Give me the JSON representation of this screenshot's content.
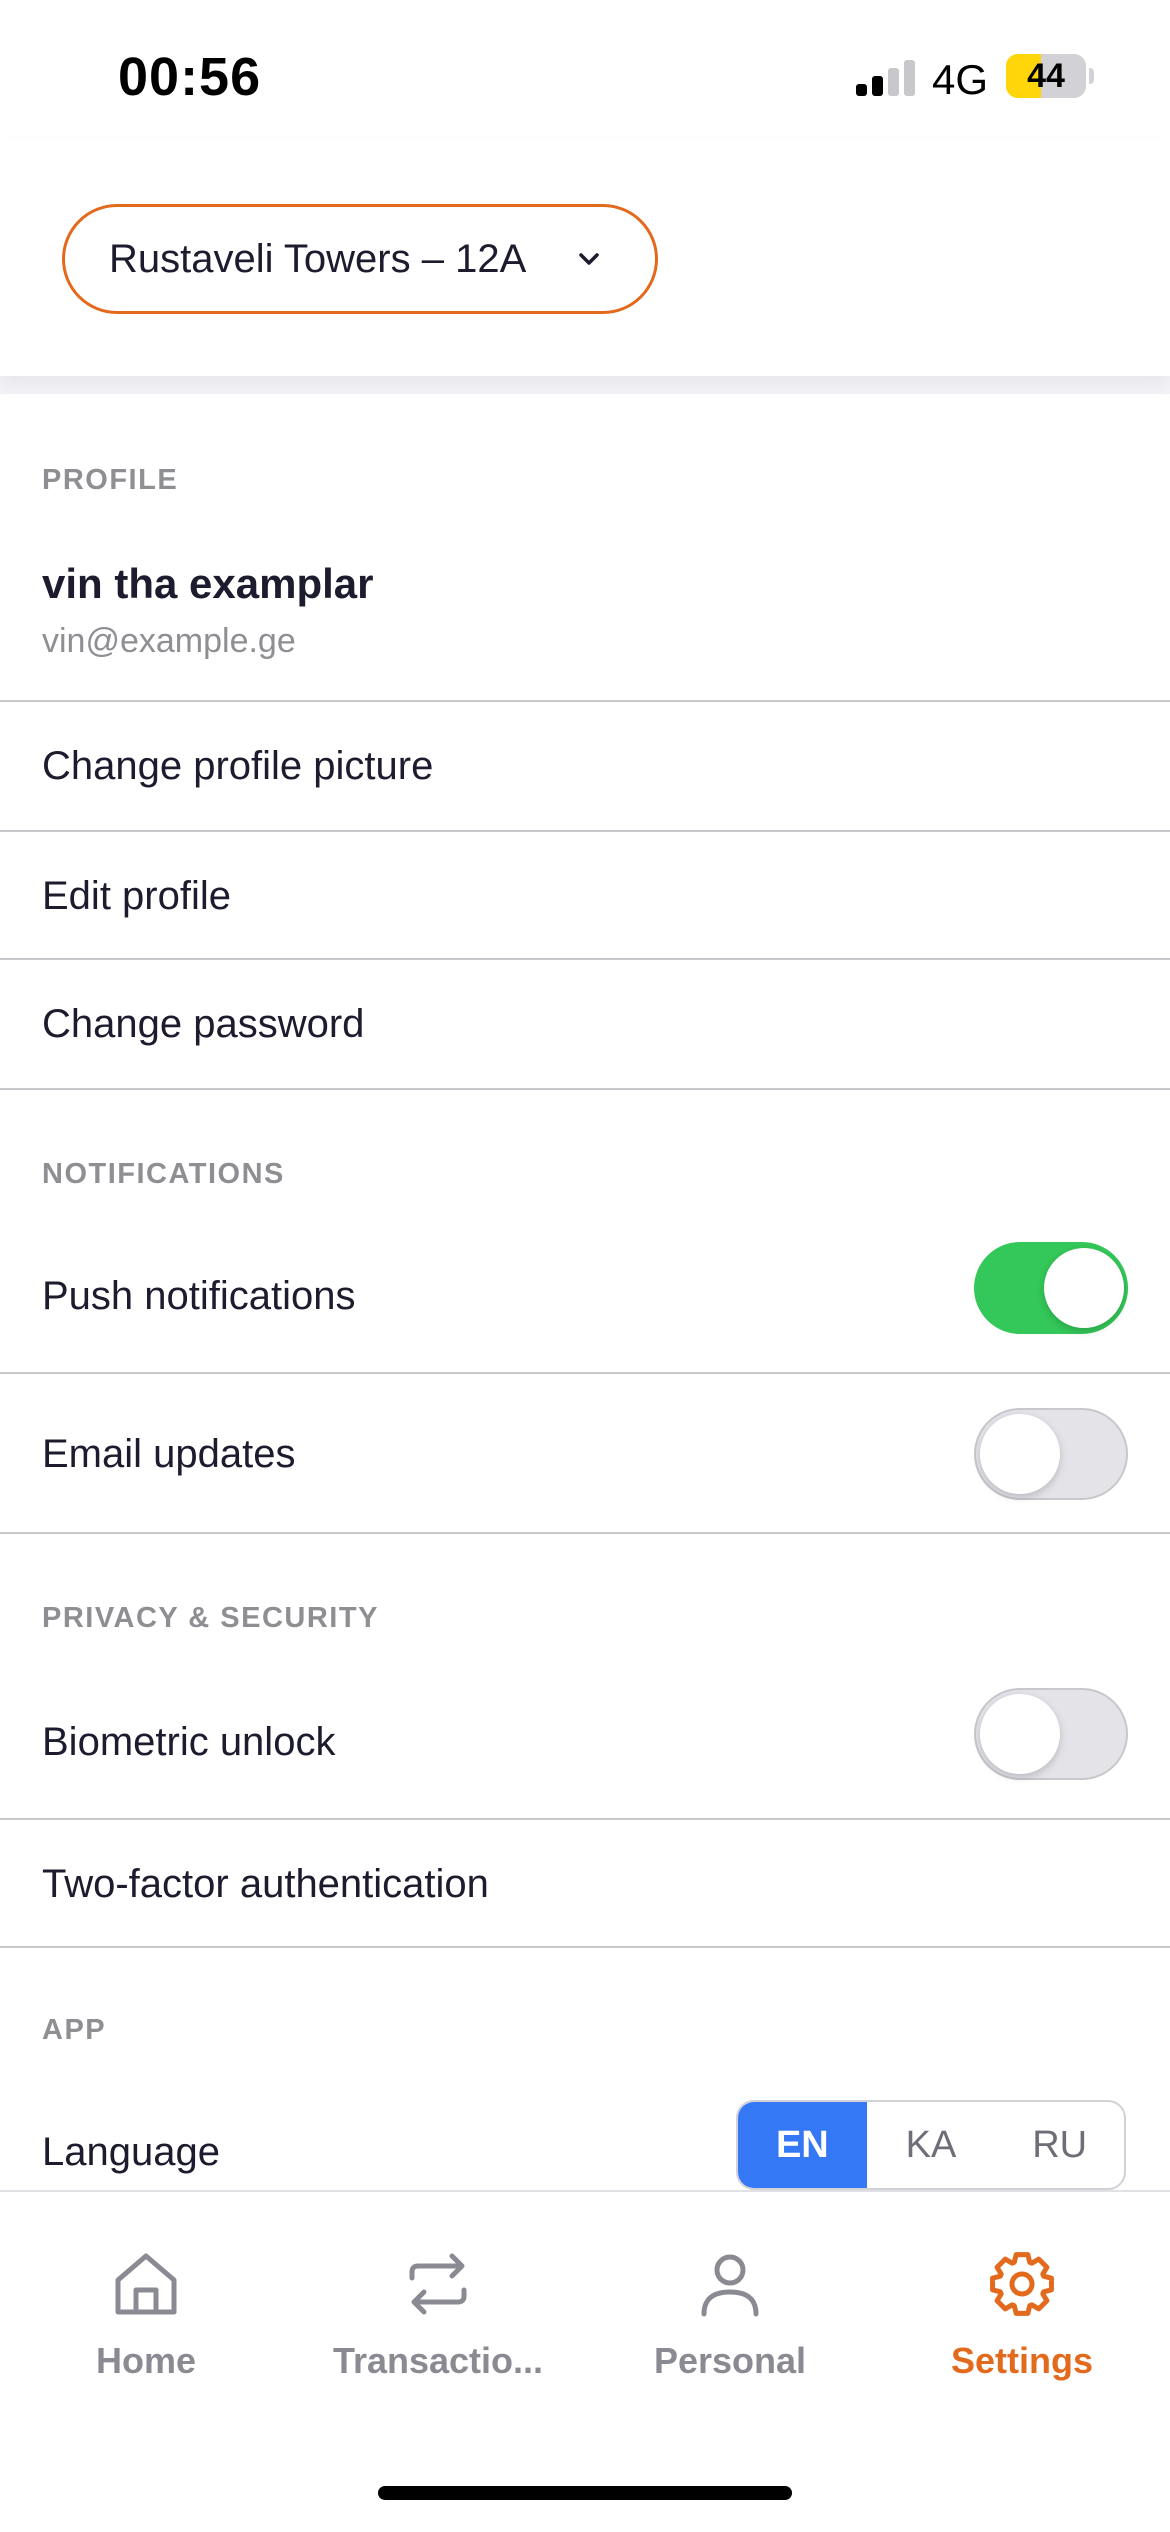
{
  "status_bar": {
    "time": "00:56",
    "network": "4G",
    "battery": "44",
    "battery_level": 0.44
  },
  "header": {
    "property_label": "Rustaveli Towers – 12A",
    "accent_color": "#e36a1c"
  },
  "profile": {
    "section_title": "PROFILE",
    "name": "vin tha examplar",
    "email": "vin@example.ge",
    "items": [
      {
        "label": "Change profile picture"
      },
      {
        "label": "Edit profile"
      },
      {
        "label": "Change password"
      }
    ]
  },
  "notifications": {
    "section_title": "NOTIFICATIONS",
    "push": {
      "label": "Push notifications",
      "enabled": true
    },
    "email": {
      "label": "Email updates",
      "enabled": false
    }
  },
  "privacy": {
    "section_title": "PRIVACY & SECURITY",
    "biometric": {
      "label": "Biometric unlock",
      "enabled": false
    },
    "two_factor": {
      "label": "Two-factor authentication"
    }
  },
  "app": {
    "section_title": "APP",
    "language": {
      "label": "Language",
      "options": [
        "EN",
        "KA",
        "RU"
      ],
      "selected": "EN"
    }
  },
  "tabbar": {
    "tabs": [
      {
        "label": "Home",
        "icon": "home-icon"
      },
      {
        "label": "Transactio...",
        "icon": "transfer-arrows-icon"
      },
      {
        "label": "Personal",
        "icon": "person-icon"
      },
      {
        "label": "Settings",
        "icon": "gear-icon",
        "active": true
      }
    ],
    "active_color": "#e36a1c",
    "inactive_color": "#8a8a93"
  }
}
